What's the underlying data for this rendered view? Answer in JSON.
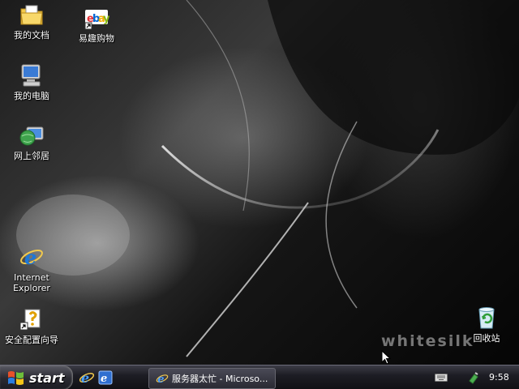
{
  "desktop": {
    "brand_text": "whitesilk",
    "icons": [
      {
        "label": "我的文档",
        "icon": "folder-documents-icon"
      },
      {
        "label": "易趣购物",
        "icon": "ebay-shortcut-icon"
      },
      {
        "label": "我的电脑",
        "icon": "computer-icon"
      },
      {
        "label": "网上邻居",
        "icon": "network-globe-icon"
      },
      {
        "label": "Internet Explorer",
        "icon": "internet-explorer-icon"
      },
      {
        "label": "安全配置向导",
        "icon": "security-wizard-shortcut-icon"
      },
      {
        "label": "回收站",
        "icon": "recycle-bin-icon"
      }
    ]
  },
  "taskbar": {
    "start_label": "start",
    "quick_launch": [
      "internet-explorer-icon",
      "internet-explorer-alt-icon"
    ],
    "task_button_label": "服务器太忙 - Microso...",
    "clock": "9:58",
    "tray_icons": [
      "keyboard-icon",
      "safely-remove-hardware-icon"
    ]
  },
  "colors": {
    "taskbar": "#1d1d24",
    "wallpaper": "#2a2a2a"
  }
}
